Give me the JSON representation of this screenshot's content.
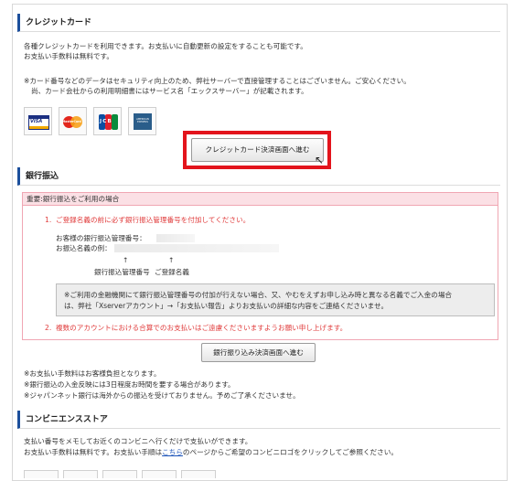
{
  "credit": {
    "title": "クレジットカード",
    "desc1": "各種クレジットカードを利用できます。お支払いに自動更新の設定をすることも可能です。",
    "desc2": "お支払い手数料は無料です。",
    "note1": "※カード番号などのデータはセキュリティ向上のため、弊社サーバーで直接管理することはございません。ご安心ください。",
    "note2": "尚、カード会社からの利用明細書にはサービス名「エックスサーバー」が記載されます。",
    "brands": [
      "VISA",
      "MasterCard",
      "JCB",
      "AMERICAN EXPRESS"
    ],
    "button": "クレジットカード決済画面へ進む"
  },
  "bank": {
    "title": "銀行振込",
    "notice_title": "重要:銀行振込をご利用の場合",
    "item1_num": "1.",
    "item1": "ご登録名義の前に必ず銀行振込管理番号を付加してください。",
    "field1": "お客様の銀行振込管理番号：",
    "field2": "お振込名義の例：",
    "arrow": "↑",
    "label_mgmt": "銀行振込管理番号",
    "label_name": "ご登録名義",
    "box_line1": "※ご利用の金融機関にて銀行振込管理番号の付加が行えない場合、又、やむをえずお申し込み時と異なる名義でご入金の場合",
    "box_line2": "は、弊社「Xserverアカウント」→「お支払い報告」よりお支払いの詳細な内容をご連絡くださいませ。",
    "item2_num": "2.",
    "item2": "複数のアカウントにおける合算でのお支払いはご遠慮くださいますようお願い申し上げます。",
    "button": "銀行振り込み決済画面へ進む",
    "foot1": "※お支払い手数料はお客様負担となります。",
    "foot2": "※銀行振込の入金反映には3日程度お時間を要する場合があります。",
    "foot3": "※ジャパンネット銀行は海外からの振込を受けておりません。予めご了承くださいませ。"
  },
  "conv": {
    "title": "コンビニエンスストア",
    "desc1": "支払い番号をメモしてお近くのコンビニへ行くだけで支払いができます。",
    "desc2_a": "お支払い手数料は無料です。お支払い手順は",
    "desc2_link": "こちら",
    "desc2_b": "のページからご希望のコンビニロゴをクリックしてご参照ください。"
  },
  "colors": {
    "accent": "#1c4f9c",
    "highlight": "#e3141c",
    "notice_border": "#f0a6b3",
    "notice_text": "#e03c3c",
    "link": "#1a52b8"
  }
}
